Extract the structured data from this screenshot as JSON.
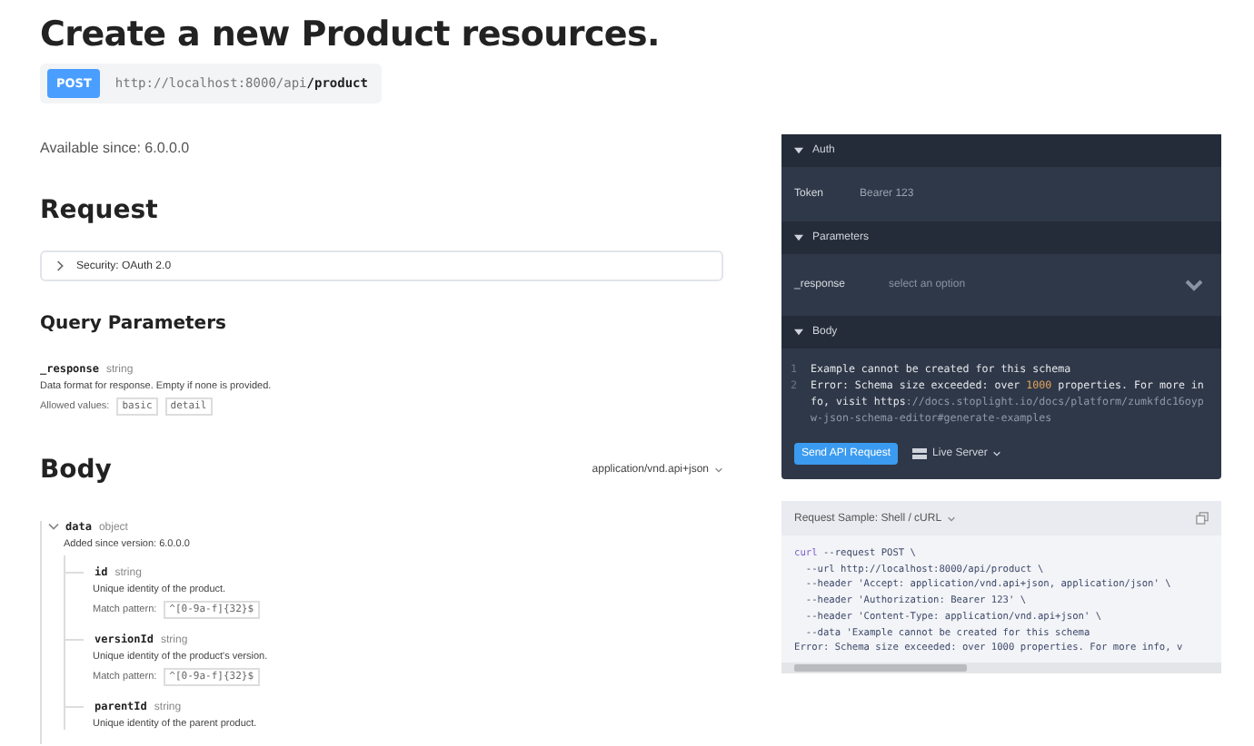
{
  "title": "Create a new Product resources.",
  "endpoint": {
    "method": "POST",
    "url_base": "http://localhost:8000/api",
    "url_path": "/product"
  },
  "available_since": "Available since: 6.0.0.0",
  "request": {
    "heading": "Request",
    "security": {
      "label": "Security: OAuth 2.0",
      "expanded": false
    }
  },
  "query_parameters": {
    "heading": "Query Parameters",
    "params": [
      {
        "name": "_response",
        "type": "string",
        "description": "Data format for response. Empty if none is provided.",
        "allowed_label": "Allowed values:",
        "allowed_values": [
          "basic",
          "detail"
        ]
      }
    ]
  },
  "body": {
    "heading": "Body",
    "content_type": "application/vnd.api+json",
    "fields": [
      {
        "name": "data",
        "type": "object",
        "expanded": true,
        "note": "Added since version: 6.0.0.0",
        "children": [
          {
            "name": "id",
            "type": "string",
            "description": "Unique identity of the product.",
            "pattern_label": "Match pattern:",
            "pattern": "^[0-9a-f]{32}$"
          },
          {
            "name": "versionId",
            "type": "string",
            "description": "Unique identity of the product's version.",
            "pattern_label": "Match pattern:",
            "pattern": "^[0-9a-f]{32}$"
          },
          {
            "name": "parentId",
            "type": "string",
            "description": "Unique identity of the parent product."
          }
        ]
      }
    ]
  },
  "try_it": {
    "sections": [
      {
        "kind": "field",
        "title": "Auth",
        "expanded": true,
        "label": "Token",
        "value": "Bearer 123"
      },
      {
        "kind": "select",
        "title": "Parameters",
        "expanded": true,
        "label": "_response",
        "placeholder": "select an option"
      },
      {
        "kind": "code",
        "title": "Body",
        "expanded": true,
        "lines": [
          {
            "number": "1",
            "segments": [
              {
                "kind": "plain",
                "text": "Example cannot be created for this schema"
              }
            ]
          },
          {
            "number": "2",
            "segments": [
              {
                "kind": "plain",
                "text": "Error: Schema size exceeded: over "
              },
              {
                "kind": "number",
                "text": "1000"
              },
              {
                "kind": "plain",
                "text": " properties. For more info, visit https"
              },
              {
                "kind": "dim",
                "text": "://docs.stoplight.io/docs/platform/zumkfdc16oypw-json-schema-editor#generate-examples"
              }
            ]
          }
        ]
      }
    ],
    "send_button": "Send API Request",
    "server": "Live Server"
  },
  "request_sample": {
    "title": "Request Sample: Shell / cURL",
    "lines": [
      [
        {
          "kind": "keyword",
          "text": "curl"
        },
        {
          "kind": "plain",
          "text": " --request POST \\"
        }
      ],
      [
        {
          "kind": "plain",
          "text": "  --url http://localhost:8000/api/product \\"
        }
      ],
      [
        {
          "kind": "plain",
          "text": "  --header 'Accept: application/vnd.api+json, application/json' \\"
        }
      ],
      [
        {
          "kind": "plain",
          "text": "  --header 'Authorization: Bearer 123' \\"
        }
      ],
      [
        {
          "kind": "plain",
          "text": "  --header 'Content-Type: application/vnd.api+json' \\"
        }
      ],
      [
        {
          "kind": "plain",
          "text": "  --data 'Example cannot be created for this schema"
        }
      ],
      [
        {
          "kind": "plain",
          "text": "Error: Schema size exceeded: over 1000 properties. For more info, v"
        }
      ]
    ]
  }
}
